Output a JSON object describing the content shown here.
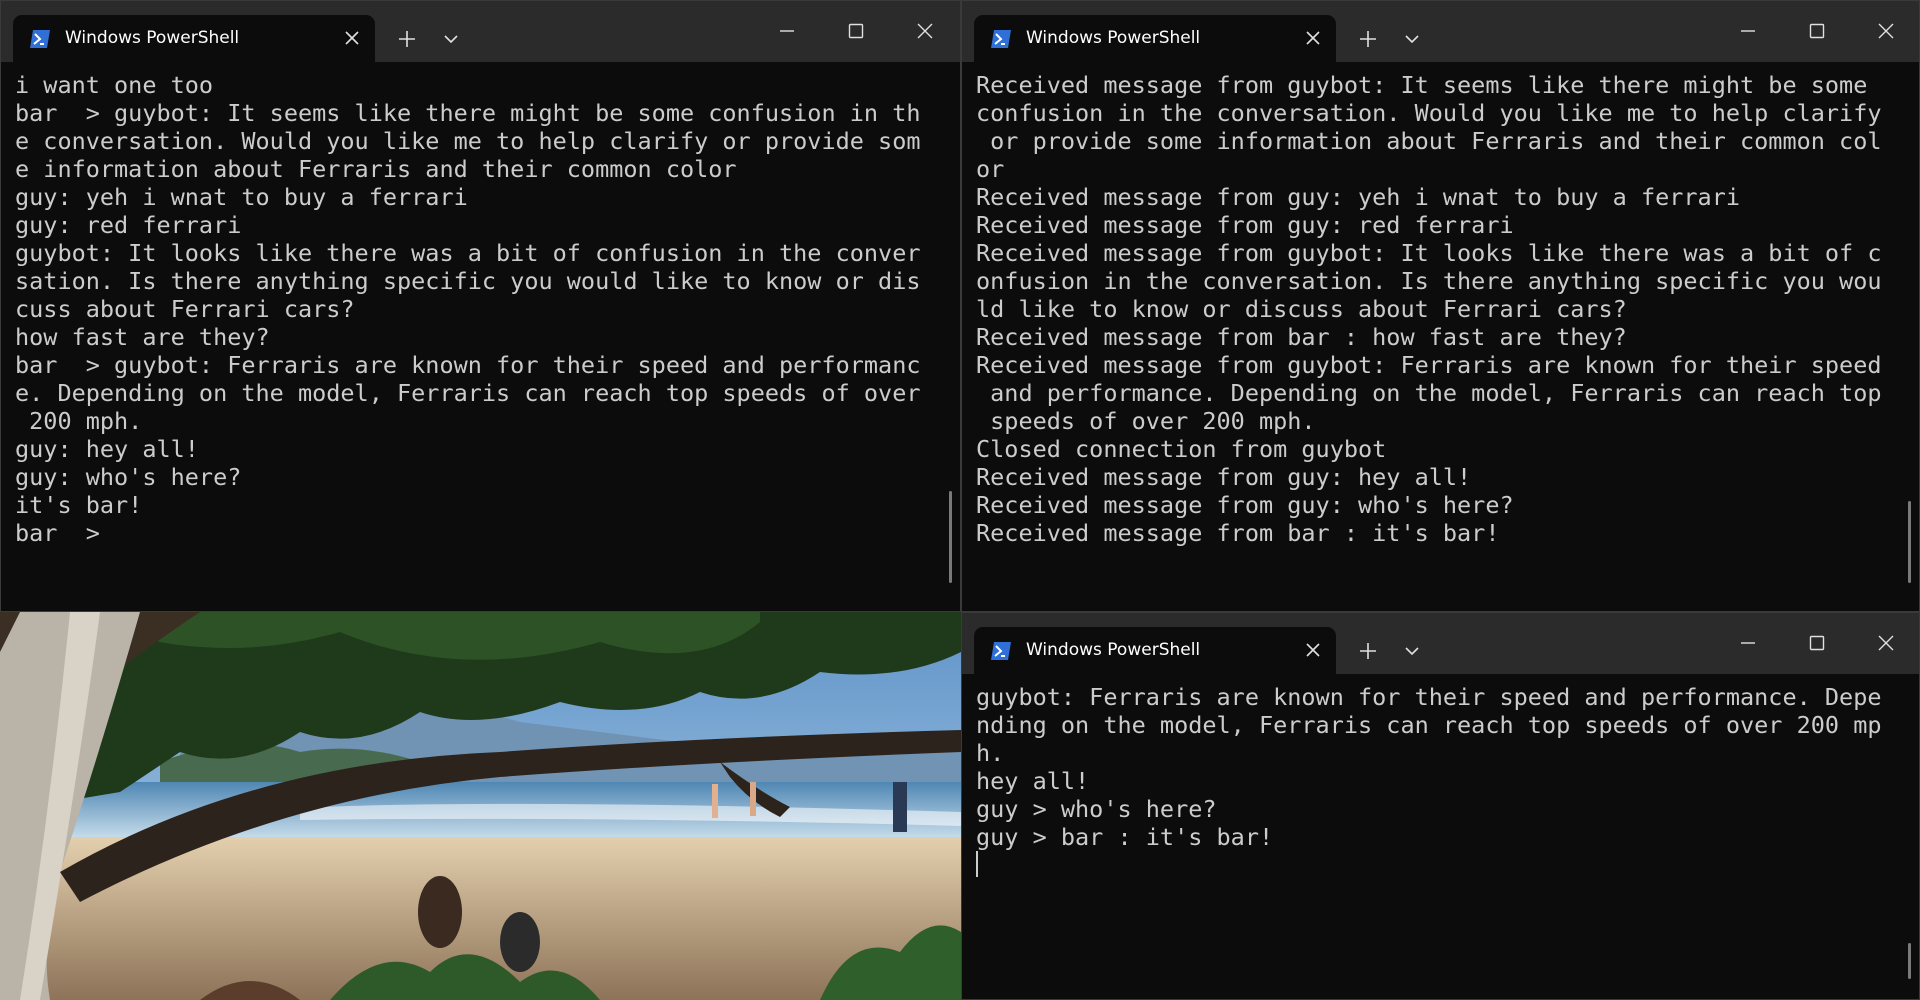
{
  "icons": {
    "powershell": "powershell-icon",
    "close": "close-icon",
    "plus": "plus-icon",
    "chevron": "chevron-down-icon",
    "minimize": "minimize-icon",
    "maximize": "maximize-icon"
  },
  "colors": {
    "titlebar": "#2b2b2b",
    "terminal_bg": "#0c0c0c",
    "terminal_text": "#cccccc",
    "powershell_blue": "#2f6fd6"
  },
  "windows": {
    "top_left": {
      "tab_title": "Windows PowerShell",
      "lines": [
        "i want one too",
        "bar  > guybot: It seems like there might be some confusion in th",
        "e conversation. Would you like me to help clarify or provide som",
        "e information about Ferraris and their common color",
        "guy: yeh i wnat to buy a ferrari",
        "guy: red ferrari",
        "guybot: It looks like there was a bit of confusion in the conver",
        "sation. Is there anything specific you would like to know or dis",
        "cuss about Ferrari cars?",
        "how fast are they?",
        "bar  > guybot: Ferraris are known for their speed and performanc",
        "e. Depending on the model, Ferraris can reach top speeds of over",
        " 200 mph.",
        "guy: hey all!",
        "guy: who's here?",
        "it's bar!",
        "bar  >"
      ]
    },
    "top_right": {
      "tab_title": "Windows PowerShell",
      "lines": [
        "Received message from guybot: It seems like there might be some",
        "confusion in the conversation. Would you like me to help clarify",
        " or provide some information about Ferraris and their common col",
        "or",
        "Received message from guy: yeh i wnat to buy a ferrari",
        "Received message from guy: red ferrari",
        "Received message from guybot: It looks like there was a bit of c",
        "onfusion in the conversation. Is there anything specific you wou",
        "ld like to know or discuss about Ferrari cars?",
        "Received message from bar : how fast are they?",
        "Received message from guybot: Ferraris are known for their speed",
        " and performance. Depending on the model, Ferraris can reach top",
        " speeds of over 200 mph.",
        "Closed connection from guybot",
        "Received message from guy: hey all!",
        "Received message from guy: who's here?",
        "Received message from bar : it's bar!"
      ]
    },
    "bottom_right": {
      "tab_title": "Windows PowerShell",
      "lines": [
        "guybot: Ferraris are known for their speed and performance. Depe",
        "nding on the model, Ferraris can reach top speeds of over 200 mp",
        "h.",
        "hey all!",
        "guy > who's here?",
        "guy > bar : it's bar!"
      ]
    }
  }
}
